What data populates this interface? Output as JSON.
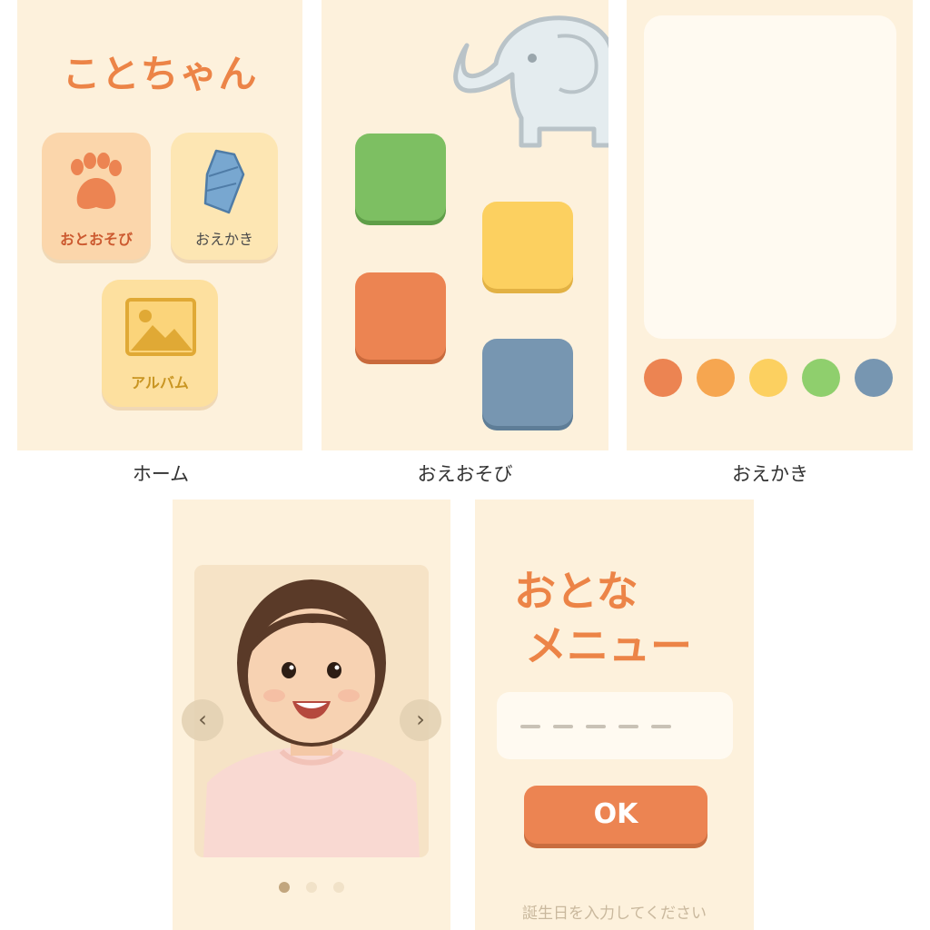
{
  "screens": {
    "home": {
      "caption": "ホーム",
      "title": "ことちゃん",
      "tiles": [
        {
          "label": "おとおそび",
          "icon": "paw-icon"
        },
        {
          "label": "おえかき",
          "icon": "crayon-icon"
        },
        {
          "label": "アルバム",
          "icon": "photo-icon"
        }
      ]
    },
    "play": {
      "caption": "おえおそび",
      "mascot": "elephant-icon",
      "blocks": [
        {
          "color": "#7dbf62",
          "name": "green-block"
        },
        {
          "color": "#fcd060",
          "name": "yellow-block"
        },
        {
          "color": "#ec8452",
          "name": "orange-block"
        },
        {
          "color": "#7796b1",
          "name": "blue-block"
        }
      ]
    },
    "draw": {
      "caption": "おえかき",
      "palette": [
        "#ec8452",
        "#f6a650",
        "#fcd060",
        "#8fcf6d",
        "#7796b1"
      ]
    },
    "album": {
      "prev": "‹",
      "next": "›",
      "page_count": 3,
      "current_page": 1
    },
    "adult": {
      "title_line1": "おとな",
      "title_line2": "メニュー",
      "password_length": 5,
      "ok_label": "OK",
      "hint": "誕生日を入力してください"
    }
  },
  "colors": {
    "accent": "#ec8447",
    "screen_bg": "#fdf1dc"
  }
}
